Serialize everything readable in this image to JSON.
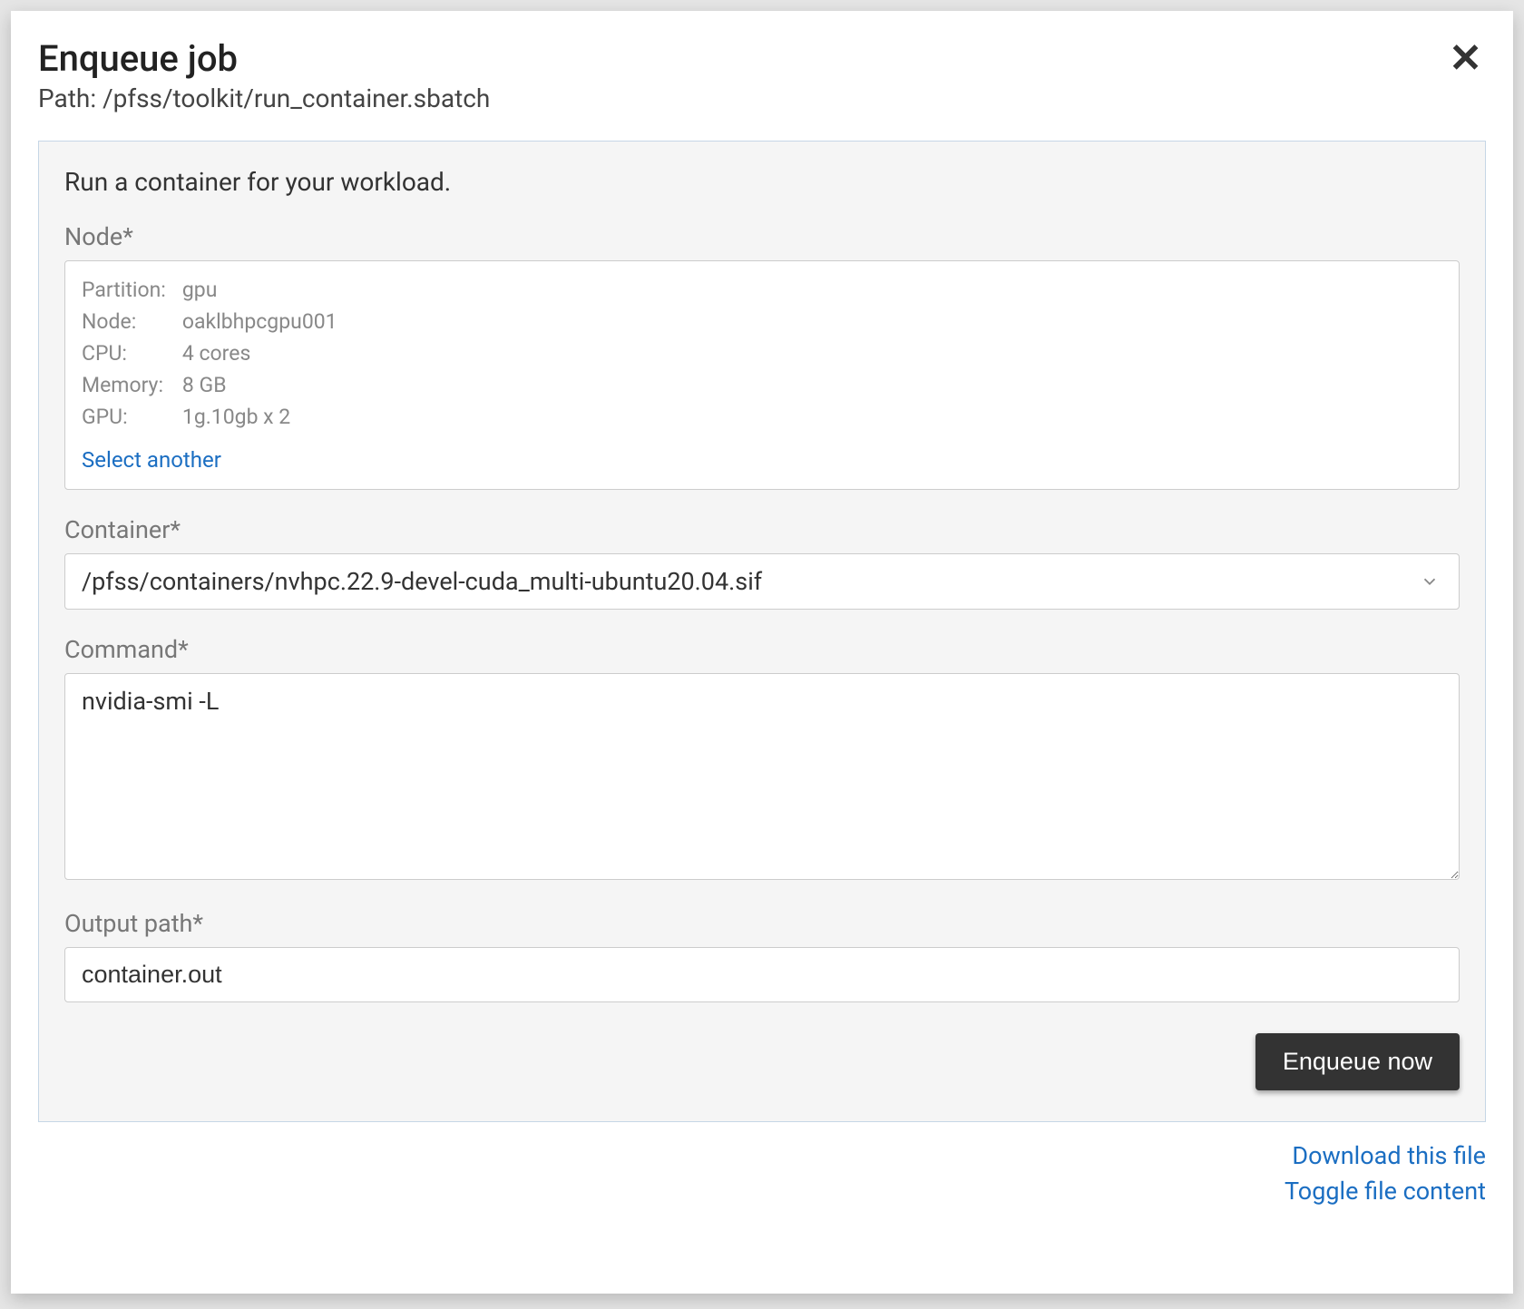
{
  "modal": {
    "title": "Enqueue job",
    "path_label_prefix": "Path: ",
    "path": "/pfss/toolkit/run_container.sbatch",
    "close_glyph": "✕"
  },
  "panel": {
    "description": "Run a container for your workload.",
    "node": {
      "label": "Node*",
      "rows": {
        "partition_k": "Partition:",
        "partition_v": "gpu",
        "node_k": "Node:",
        "node_v": "oaklbhpcgpu001",
        "cpu_k": "CPU:",
        "cpu_v": "4 cores",
        "memory_k": "Memory:",
        "memory_v": "8 GB",
        "gpu_k": "GPU:",
        "gpu_v": "1g.10gb x 2"
      },
      "select_another": "Select another"
    },
    "container": {
      "label": "Container*",
      "value": "/pfss/containers/nvhpc.22.9-devel-cuda_multi-ubuntu20.04.sif"
    },
    "command": {
      "label": "Command*",
      "value": "nvidia-smi -L"
    },
    "output": {
      "label": "Output path*",
      "value": "container.out"
    },
    "enqueue_button": "Enqueue now"
  },
  "footer": {
    "download": "Download this file",
    "toggle": "Toggle file content"
  }
}
